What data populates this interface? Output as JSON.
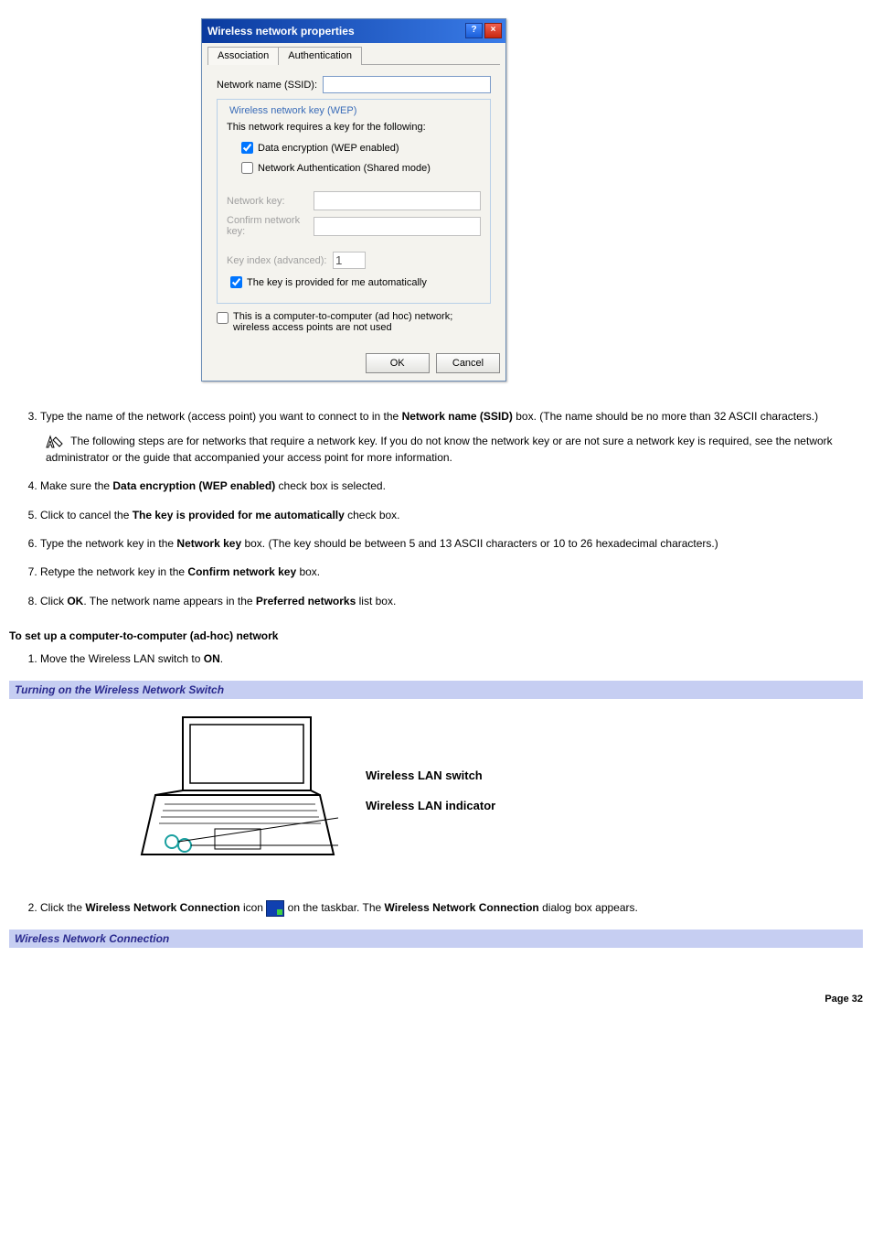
{
  "dialog": {
    "title": "Wireless network properties",
    "help_btn": "?",
    "close_btn": "×",
    "tabs": {
      "association": "Association",
      "authentication": "Authentication"
    },
    "ssid_label": "Network name (SSID):",
    "ssid_value": "",
    "wep_legend": "Wireless network key (WEP)",
    "subtext": "This network requires a key for the following:",
    "cb_data_enc": "Data encryption (WEP enabled)",
    "cb_net_auth": "Network Authentication (Shared mode)",
    "netkey_label": "Network key:",
    "confirm_label": "Confirm network key:",
    "keyindex_label": "Key index (advanced):",
    "keyindex_value": "1",
    "cb_auto_key": "The key is provided for me automatically",
    "cb_adhoc": "This is a computer-to-computer (ad hoc) network; wireless access points are not used",
    "ok": "OK",
    "cancel": "Cancel"
  },
  "steps_a": {
    "s3a": "Type the name of the network (access point) you want to connect to in the ",
    "s3b": "Network name (SSID)",
    "s3c": " box. (The name should be no more than 32 ASCII characters.)",
    "note": "The following steps are for networks that require a network key. If you do not know the network key or are not sure a network key is required, see the network administrator or the guide that accompanied your access point for more information.",
    "s4a": "Make sure the ",
    "s4b": "Data encryption (WEP enabled)",
    "s4c": " check box is selected.",
    "s5a": "Click to cancel the ",
    "s5b": "The key is provided for me automatically",
    "s5c": " check box.",
    "s6a": "Type the network key in the ",
    "s6b": "Network key",
    "s6c": " box. (The key should be between 5 and 13 ASCII characters or 10 to 26 hexadecimal characters.)",
    "s7a": "Retype the network key in the ",
    "s7b": "Confirm network key",
    "s7c": " box.",
    "s8a": "Click ",
    "s8b": "OK",
    "s8c": ". The network name appears in the ",
    "s8d": "Preferred networks",
    "s8e": " list box."
  },
  "heading_adhoc": "To set up a computer-to-computer (ad-hoc) network",
  "steps_b": {
    "s1a": "Move the Wireless LAN switch to ",
    "s1b": "ON",
    "s1c": ".",
    "s2a": "Click the ",
    "s2b": "Wireless Network Connection",
    "s2c": " icon ",
    "s2d": " on the taskbar. The ",
    "s2e": "Wireless Network Connection",
    "s2f": " dialog box appears."
  },
  "banner1": "Turning on the Wireless Network Switch",
  "labels": {
    "switch": "Wireless LAN switch",
    "indicator": "Wireless LAN indicator"
  },
  "banner2": "Wireless Network Connection",
  "footer": "Page 32"
}
